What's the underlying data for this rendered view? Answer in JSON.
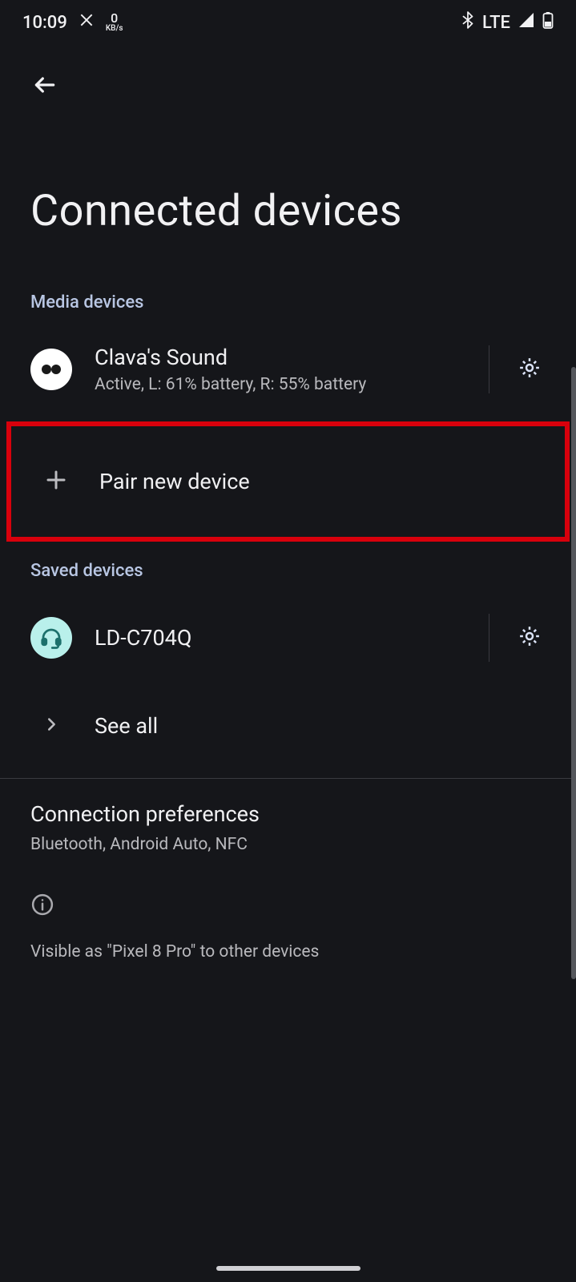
{
  "status_bar": {
    "time": "10:09",
    "kbps_value": "0",
    "kbps_unit": "KB/s",
    "network": "LTE"
  },
  "page_title": "Connected devices",
  "sections": {
    "media": {
      "header": "Media devices",
      "device": {
        "name": "Clava's Sound",
        "status": "Active, L: 61% battery, R: 55% battery"
      },
      "pair": "Pair new device"
    },
    "saved": {
      "header": "Saved devices",
      "device": {
        "name": "LD-C704Q"
      },
      "see_all": "See all"
    }
  },
  "connection_prefs": {
    "title": "Connection preferences",
    "subtitle": "Bluetooth, Android Auto, NFC"
  },
  "footer_info": "Visible as \"Pixel 8 Pro\" to other devices"
}
